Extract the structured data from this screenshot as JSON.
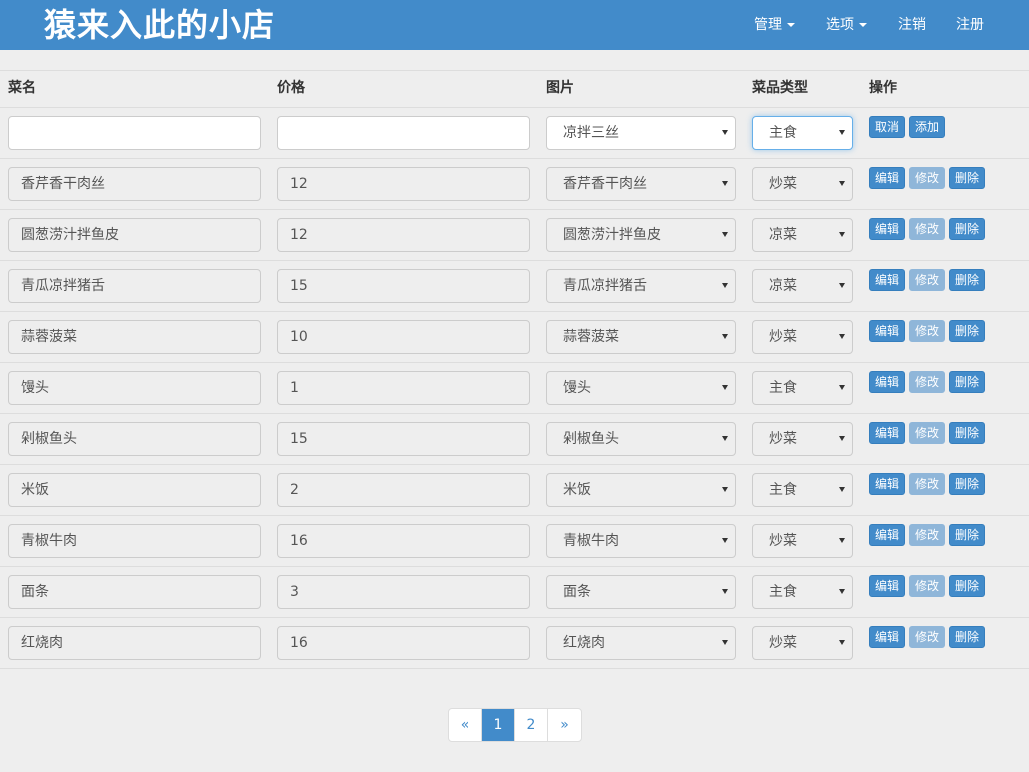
{
  "navbar": {
    "brand": "猿来入此的小店",
    "menu_manage": "管理",
    "menu_options": "选项",
    "logout": "注销",
    "register": "注册"
  },
  "table": {
    "headers": [
      "菜名",
      "价格",
      "图片",
      "菜品类型",
      "操作"
    ],
    "new_row": {
      "name": "",
      "price": "",
      "image": "凉拌三丝",
      "type": "主食",
      "cancel_label": "取消",
      "add_label": "添加"
    },
    "action_labels": {
      "edit": "编辑",
      "modify": "修改",
      "delete": "删除"
    },
    "rows": [
      {
        "name": "香芹香干肉丝",
        "price": "12",
        "image": "香芹香干肉丝",
        "type": "炒菜"
      },
      {
        "name": "圆葱涝汁拌鱼皮",
        "price": "12",
        "image": "圆葱涝汁拌鱼皮",
        "type": "凉菜"
      },
      {
        "name": "青瓜凉拌猪舌",
        "price": "15",
        "image": "青瓜凉拌猪舌",
        "type": "凉菜"
      },
      {
        "name": "蒜蓉菠菜",
        "price": "10",
        "image": "蒜蓉菠菜",
        "type": "炒菜"
      },
      {
        "name": "馒头",
        "price": "1",
        "image": "馒头",
        "type": "主食"
      },
      {
        "name": "剁椒鱼头",
        "price": "15",
        "image": "剁椒鱼头",
        "type": "炒菜"
      },
      {
        "name": "米饭",
        "price": "2",
        "image": "米饭",
        "type": "主食"
      },
      {
        "name": "青椒牛肉",
        "price": "16",
        "image": "青椒牛肉",
        "type": "炒菜"
      },
      {
        "name": "面条",
        "price": "3",
        "image": "面条",
        "type": "主食"
      },
      {
        "name": "红烧肉",
        "price": "16",
        "image": "红烧肉",
        "type": "炒菜"
      }
    ]
  },
  "pagination": {
    "prev": "«",
    "pages": [
      "1",
      "2"
    ],
    "next": "»",
    "active": "1"
  },
  "colors": {
    "primary": "#428bca",
    "background": "#eeeeee"
  }
}
